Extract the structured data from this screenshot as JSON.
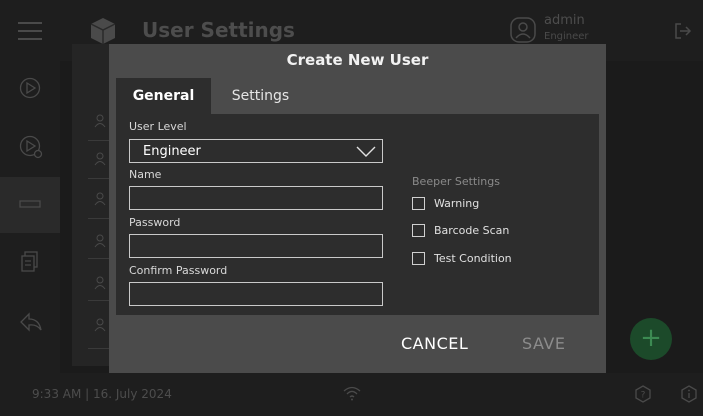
{
  "header": {
    "app_title": "User Settings",
    "user_name": "admin",
    "user_role": "Engineer",
    "icons": [
      "menu-icon",
      "logo-icon",
      "user-icon",
      "logout-icon"
    ]
  },
  "sidebar": {
    "items": [
      {
        "name": "play-icon"
      },
      {
        "name": "play-settings-icon"
      },
      {
        "name": "users-icon",
        "active": true
      },
      {
        "name": "documents-icon"
      },
      {
        "name": "back-icon"
      }
    ]
  },
  "footer": {
    "datetime": "9:33 AM | 16. July 2024",
    "icons": [
      "wifi-icon",
      "help-icon",
      "info-icon"
    ]
  },
  "modal": {
    "title": "Create New User",
    "tabs": [
      {
        "label": "General",
        "active": true
      },
      {
        "label": "Settings",
        "active": false
      }
    ],
    "user_level": {
      "label": "User Level",
      "value": "Engineer"
    },
    "name": {
      "label": "Name",
      "value": ""
    },
    "password": {
      "label": "Password",
      "value": ""
    },
    "confirm_password": {
      "label": "Confirm Password",
      "value": ""
    },
    "beeper": {
      "title": "Beeper Settings",
      "options": [
        {
          "label": "Warning",
          "checked": false
        },
        {
          "label": "Barcode Scan",
          "checked": false
        },
        {
          "label": "Test Condition",
          "checked": false
        }
      ]
    },
    "cancel_label": "CANCEL",
    "save_label": "SAVE"
  },
  "fab_label": "+",
  "colors": {
    "modal_bg": "#4b4b4b",
    "panel_bg": "#2d2d2d",
    "fab_bg": "#1c4a2a",
    "save_disabled": "#8c8c8c"
  }
}
